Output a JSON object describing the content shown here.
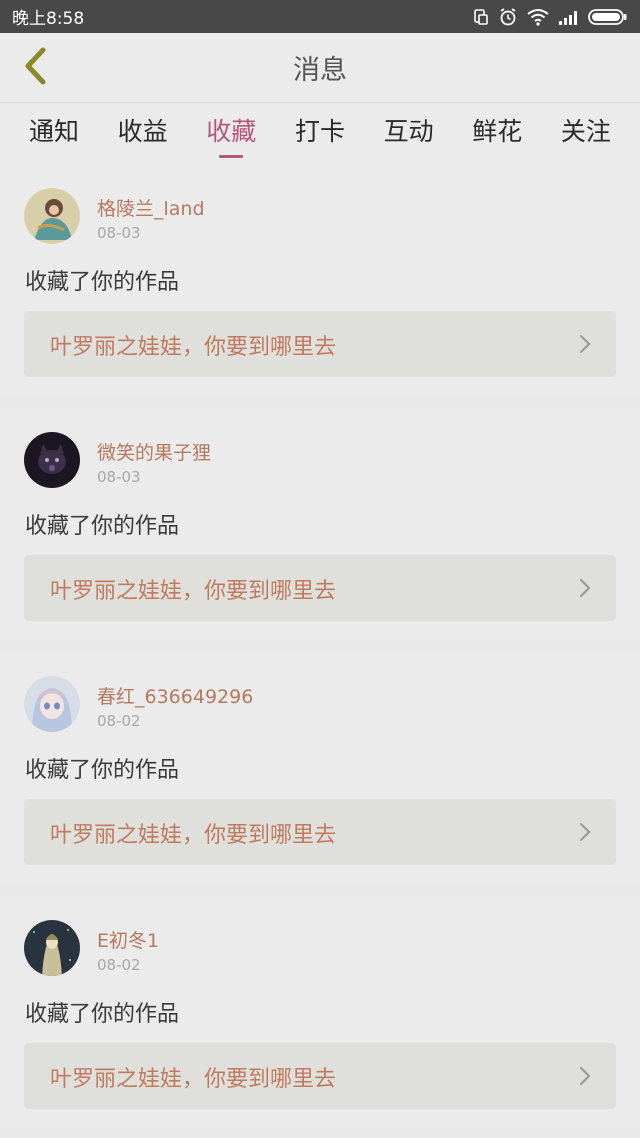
{
  "status_bar": {
    "time": "晚上8:58",
    "icons": [
      "screen-rotate-icon",
      "alarm-icon",
      "wifi-icon",
      "signal-icon",
      "battery-icon"
    ]
  },
  "header": {
    "title": "消息",
    "back_icon": "chevron-left-icon"
  },
  "tabs": [
    {
      "label": "通知",
      "active": false
    },
    {
      "label": "收益",
      "active": false
    },
    {
      "label": "收藏",
      "active": true
    },
    {
      "label": "打卡",
      "active": false
    },
    {
      "label": "互动",
      "active": false
    },
    {
      "label": "鲜花",
      "active": false
    },
    {
      "label": "关注",
      "active": false
    }
  ],
  "notifications": [
    {
      "user": "格陵兰_land",
      "date": "08-03",
      "action": "收藏了你的作品",
      "work": "叶罗丽之娃娃，你要到哪里去"
    },
    {
      "user": "微笑的果子狸",
      "date": "08-03",
      "action": "收藏了你的作品",
      "work": "叶罗丽之娃娃，你要到哪里去"
    },
    {
      "user": "春红_636649296",
      "date": "08-02",
      "action": "收藏了你的作品",
      "work": "叶罗丽之娃娃，你要到哪里去"
    },
    {
      "user": "E初冬1",
      "date": "08-02",
      "action": "收藏了你的作品",
      "work": "叶罗丽之娃娃，你要到哪里去"
    }
  ],
  "colors": {
    "accent": "#b5577a",
    "username": "#b57a5e",
    "work_title": "#c17a5e",
    "status_bar": "#484848",
    "background": "#e9e9e9"
  }
}
